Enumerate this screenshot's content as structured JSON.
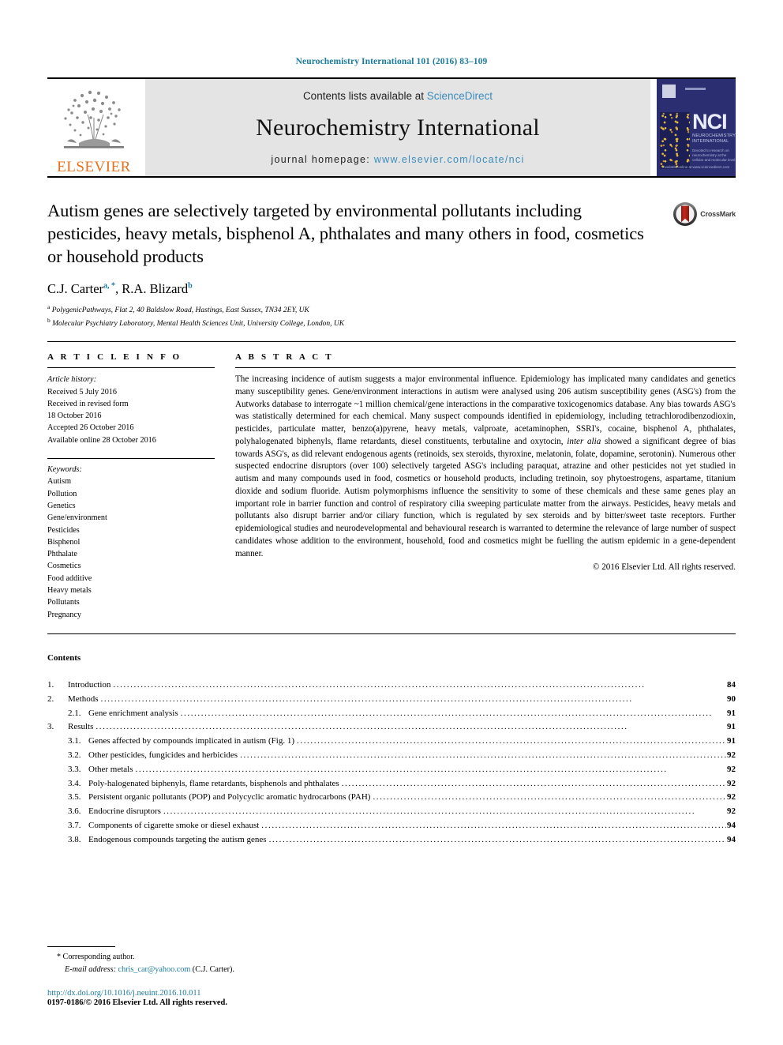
{
  "running_head": "Neurochemistry International 101 (2016) 83–109",
  "masthead": {
    "publisher_wordmark": "ELSEVIER",
    "contents_prefix": "Contents lists available at ",
    "contents_link": "ScienceDirect",
    "journal_title": "Neurochemistry International",
    "homepage_prefix": "journal homepage: ",
    "homepage_url": "www.elsevier.com/locate/nci",
    "cover": {
      "acronym": "NCI",
      "sub_title": "NEUROCHEMISTRY INTERNATIONAL",
      "sub_meta": "Devoted to research on\nneurochemistry at the cellular\nand molecular level",
      "footer": "Available online at\nwww.sciencedirect.com"
    }
  },
  "article": {
    "title": "Autism genes are selectively targeted by environmental pollutants including pesticides, heavy metals, bisphenol A, phthalates and many others in food, cosmetics or household products",
    "crossmark_label": "CrossMark",
    "authors": [
      {
        "name": "C.J. Carter",
        "marks": "a, *"
      },
      {
        "name": "R.A. Blizard",
        "marks": "b"
      }
    ],
    "affiliations": [
      {
        "mark": "a",
        "text": "PolygenicPathways, Flat 2, 40 Baldslow Road, Hastings, East Sussex, TN34 2EY, UK"
      },
      {
        "mark": "b",
        "text": "Molecular Psychiatry Laboratory, Mental Health Sciences Unit, University College, London, UK"
      }
    ]
  },
  "article_info": {
    "heading": "A R T I C L E   I N F O",
    "history_label": "Article history:",
    "history": [
      "Received 5 July 2016",
      "Received in revised form",
      "18 October 2016",
      "Accepted 26 October 2016",
      "Available online 28 October 2016"
    ],
    "keywords_label": "Keywords:",
    "keywords": [
      "Autism",
      "Pollution",
      "Genetics",
      "Gene/environment",
      "Pesticides",
      "Bisphenol",
      "Phthalate",
      "Cosmetics",
      "Food additive",
      "Heavy metals",
      "Pollutants",
      "Pregnancy"
    ]
  },
  "abstract": {
    "heading": "A B S T R A C T",
    "part1": "The increasing incidence of autism suggests a major environmental influence. Epidemiology has implicated many candidates and genetics many susceptibility genes. Gene/environment interactions in autism were analysed using 206 autism susceptibility genes (ASG's) from the Autworks database to interrogate ~1 million chemical/gene interactions in the comparative toxicogenomics database. Any bias towards ASG's was statistically determined for each chemical. Many suspect compounds identified in epidemiology, including tetrachlorodibenzodioxin, pesticides, particulate matter, benzo(a)pyrene, heavy metals, valproate, acetaminophen, SSRI's, cocaine, bisphenol A, phthalates, polyhalogenated biphenyls, flame retardants, diesel constituents, terbutaline and oxytocin, ",
    "italic": "inter alia",
    "part2": " showed a significant degree of bias towards ASG's, as did relevant endogenous agents (retinoids, sex steroids, thyroxine, melatonin, folate, dopamine, serotonin). Numerous other suspected endocrine disruptors (over 100) selectively targeted ASG's including paraquat, atrazine and other pesticides not yet studied in autism and many compounds used in food, cosmetics or household products, including tretinoin, soy phytoestrogens, aspartame, titanium dioxide and sodium fluoride. Autism polymorphisms influence the sensitivity to some of these chemicals and these same genes play an important role in barrier function and control of respiratory cilia sweeping particulate matter from the airways. Pesticides, heavy metals and pollutants also disrupt barrier and/or ciliary function, which is regulated by sex steroids and by bitter/sweet taste receptors. Further epidemiological studies and neurodevelopmental and behavioural research is warranted to determine the relevance of large number of suspect candidates whose addition to the environment, household, food and cosmetics might be fuelling the autism epidemic in a gene-dependent manner.",
    "copyright": "© 2016 Elsevier Ltd. All rights reserved."
  },
  "contents": {
    "heading": "Contents",
    "entries": [
      {
        "level": 1,
        "num": "1.",
        "label": "Introduction",
        "page": "84"
      },
      {
        "level": 1,
        "num": "2.",
        "label": "Methods",
        "page": "90"
      },
      {
        "level": 2,
        "num": "2.1.",
        "label": "Gene enrichment analysis",
        "page": "91"
      },
      {
        "level": 1,
        "num": "3.",
        "label": "Results",
        "page": "91"
      },
      {
        "level": 2,
        "num": "3.1.",
        "label": "Genes affected by compounds implicated in autism (Fig. 1)",
        "page": "91"
      },
      {
        "level": 2,
        "num": "3.2.",
        "label": "Other pesticides, fungicides and herbicides",
        "page": "92"
      },
      {
        "level": 2,
        "num": "3.3.",
        "label": "Other metals",
        "page": "92"
      },
      {
        "level": 2,
        "num": "3.4.",
        "label": "Poly-halogenated biphenyls, flame retardants, bisphenols and phthalates",
        "page": "92"
      },
      {
        "level": 2,
        "num": "3.5.",
        "label": "Persistent organic pollutants (POP) and Polycyclic aromatic hydrocarbons (PAH)",
        "page": "92"
      },
      {
        "level": 2,
        "num": "3.6.",
        "label": "Endocrine disruptors",
        "page": "92"
      },
      {
        "level": 2,
        "num": "3.7.",
        "label": "Components of cigarette smoke or diesel exhaust",
        "page": "94"
      },
      {
        "level": 2,
        "num": "3.8.",
        "label": "Endogenous compounds targeting the autism genes",
        "page": "94"
      }
    ]
  },
  "footnotes": {
    "corresponding_star": "*",
    "corresponding_text": "Corresponding author.",
    "email_label": "E-mail address:",
    "email": "chris_car@yahoo.com",
    "email_owner": "(C.J. Carter).",
    "doi": "http://dx.doi.org/10.1016/j.neuint.2016.10.011",
    "issn": "0197-0186/© 2016 Elsevier Ltd. All rights reserved."
  },
  "colors": {
    "link_blue": "#1b7b9c",
    "sciencedirect_blue": "#3b8cbb",
    "elsevier_orange": "#E9711C",
    "cover_navy": "#2b2f72"
  }
}
